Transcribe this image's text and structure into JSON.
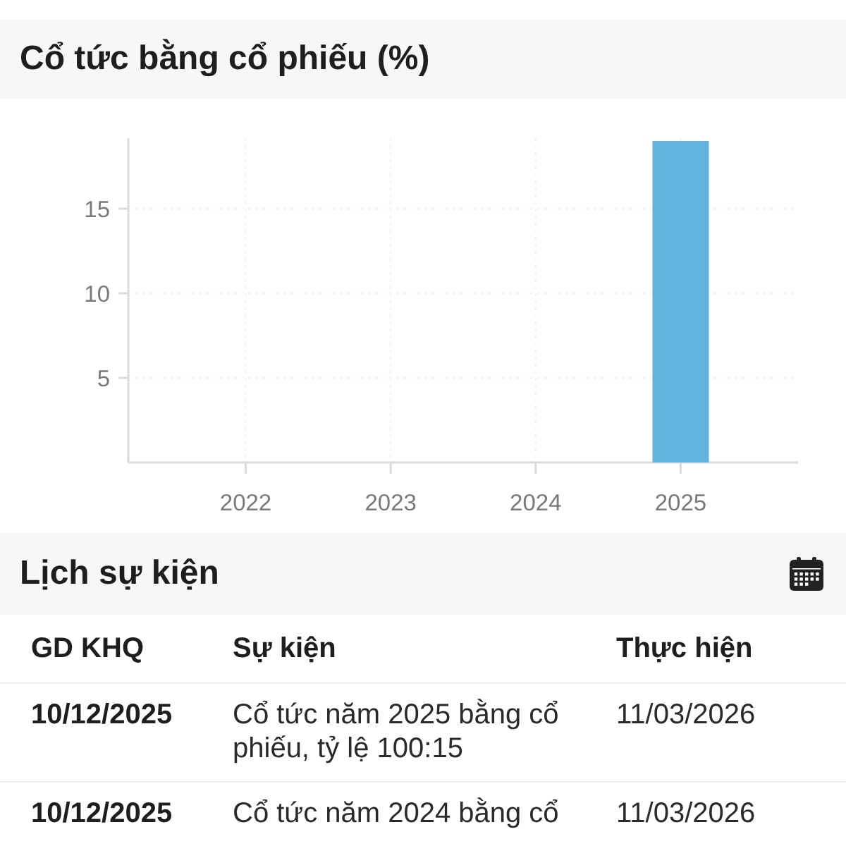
{
  "dividend_chart": {
    "title": "Cổ tức bằng cổ phiếu (%)",
    "chart_data": {
      "type": "bar",
      "categories": [
        "2022",
        "2023",
        "2024",
        "2025"
      ],
      "series": [
        {
          "color": "#62b4dc",
          "values": [
            0,
            0,
            0,
            19
          ]
        }
      ],
      "ylim": [
        0,
        19
      ],
      "yticks": [
        5,
        10,
        15
      ],
      "grid": true
    }
  },
  "events": {
    "title": "Lịch sự kiện",
    "columns": [
      "GD KHQ",
      "Sự kiện",
      "Thực hiện"
    ],
    "rows": [
      {
        "ex_date": "10/12/2025",
        "event": "Cổ tức năm 2025 bằng cổ phiếu, tỷ lệ 100:15",
        "execution_date": "11/03/2026"
      },
      {
        "ex_date": "10/12/2025",
        "event": "Cổ tức năm 2024 bằng cổ",
        "execution_date": "11/03/2026"
      }
    ]
  }
}
